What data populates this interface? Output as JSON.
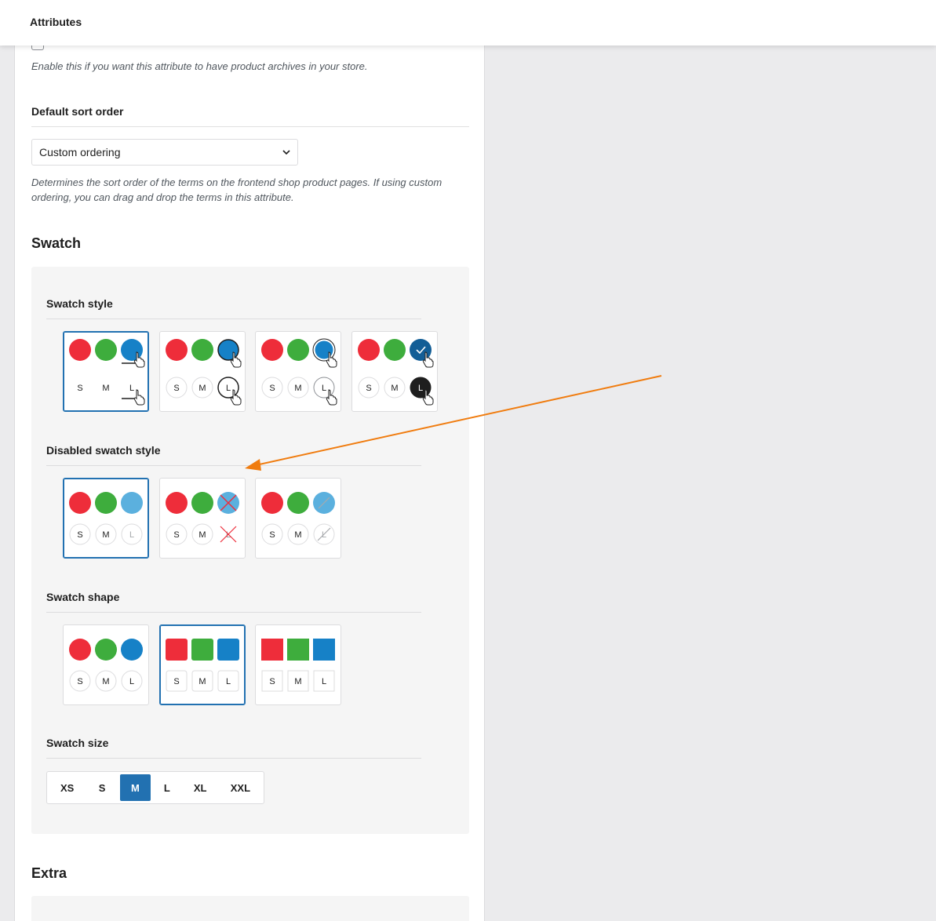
{
  "header": {
    "title": "Attributes"
  },
  "archives": {
    "description": "Enable this if you want this attribute to have product archives in your store."
  },
  "sort_order": {
    "label": "Default sort order",
    "value": "Custom ordering",
    "description_line1": "Determines the sort order of the terms on the frontend shop product pages. If using custom",
    "description_line2": "ordering, you can drag and drop the terms in this attribute."
  },
  "swatch": {
    "heading": "Swatch",
    "style": {
      "label": "Swatch style",
      "options": 4,
      "selected_index": 0
    },
    "disabled_style": {
      "label": "Disabled swatch style",
      "options": 3,
      "selected_index": 0
    },
    "shape": {
      "label": "Swatch shape",
      "options": [
        "circle",
        "rounded",
        "square"
      ],
      "selected_index": 1
    },
    "size": {
      "label": "Swatch size",
      "options": [
        "XS",
        "S",
        "M",
        "L",
        "XL",
        "XXL"
      ],
      "selected": "M"
    },
    "preview_sizes": [
      "S",
      "M",
      "L"
    ]
  },
  "extra": {
    "heading": "Extra"
  },
  "colors": {
    "red": "#ee2d3a",
    "green": "#3ead3d",
    "blue": "#1681c7",
    "accent": "#2271b1",
    "annotation": "#f07c0f"
  }
}
